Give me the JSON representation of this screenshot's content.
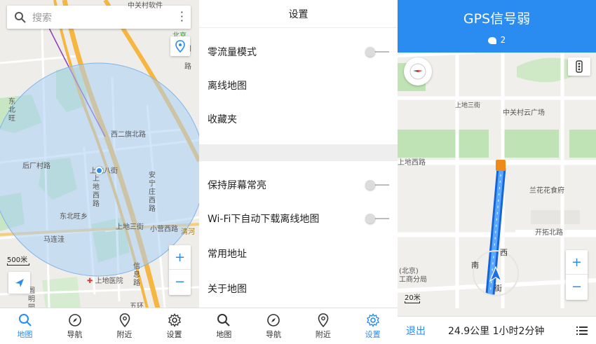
{
  "panel1": {
    "search": {
      "placeholder": "搜索"
    },
    "labels": {
      "xierqi": "西二旗北路",
      "houchang": "后厂村路",
      "dongbeiwang": "东北旺乡",
      "malianwa": "马连洼",
      "shangdi3": "上地三街",
      "xiaoying": "小营西路",
      "qinghe": "清河",
      "hospital": "上地医院",
      "shangdixi": "上地西路",
      "anning": "安宁庄西路",
      "xinxi": "信息路",
      "dongbei": "东北旺",
      "yuanmingyuan": "圆明园西",
      "wuqi": "五环",
      "top1": "中关村软件",
      "top2": "北京",
      "zhi": "知",
      "lu": "路",
      "shangdi8": "上地八街"
    },
    "scale": "500米",
    "zoom_in": "+",
    "zoom_out": "−"
  },
  "panel2": {
    "title": "设置",
    "rows": [
      {
        "label": "零流量模式"
      },
      {
        "label": "离线地图"
      },
      {
        "label": "收藏夹"
      },
      {
        "label": "保持屏幕常亮"
      },
      {
        "label": "Wi-Fi下自动下载离线地图"
      },
      {
        "label": "常用地址"
      },
      {
        "label": "关于地图"
      }
    ]
  },
  "tabs": [
    {
      "label": "地图",
      "icon": "search-icon"
    },
    {
      "label": "导航",
      "icon": "compass-icon"
    },
    {
      "label": "附近",
      "icon": "location-pin-icon"
    },
    {
      "label": "设置",
      "icon": "gear-icon"
    }
  ],
  "panel3": {
    "title": "GPS信号弱",
    "satellites": "2",
    "labels": {
      "zhongguancun": "中关村云广场",
      "shangdixi": "上地西路",
      "lanhua": "兰花花食府",
      "kaituo": "开拓北路",
      "beijing": "(北京)",
      "gongshang": "工商分局",
      "xi": "西",
      "jie": "街",
      "nan": "南",
      "street": "上地三街"
    },
    "scale": "20米",
    "zoom_in": "+",
    "zoom_out": "−",
    "exit": "退出",
    "route_info": "24.9公里  1小时2分钟"
  },
  "colors": {
    "accent": "#2a8cf0",
    "road_major": "#f5b642",
    "park": "#c8e6c3",
    "gps_circle": "#a9d0f5"
  }
}
